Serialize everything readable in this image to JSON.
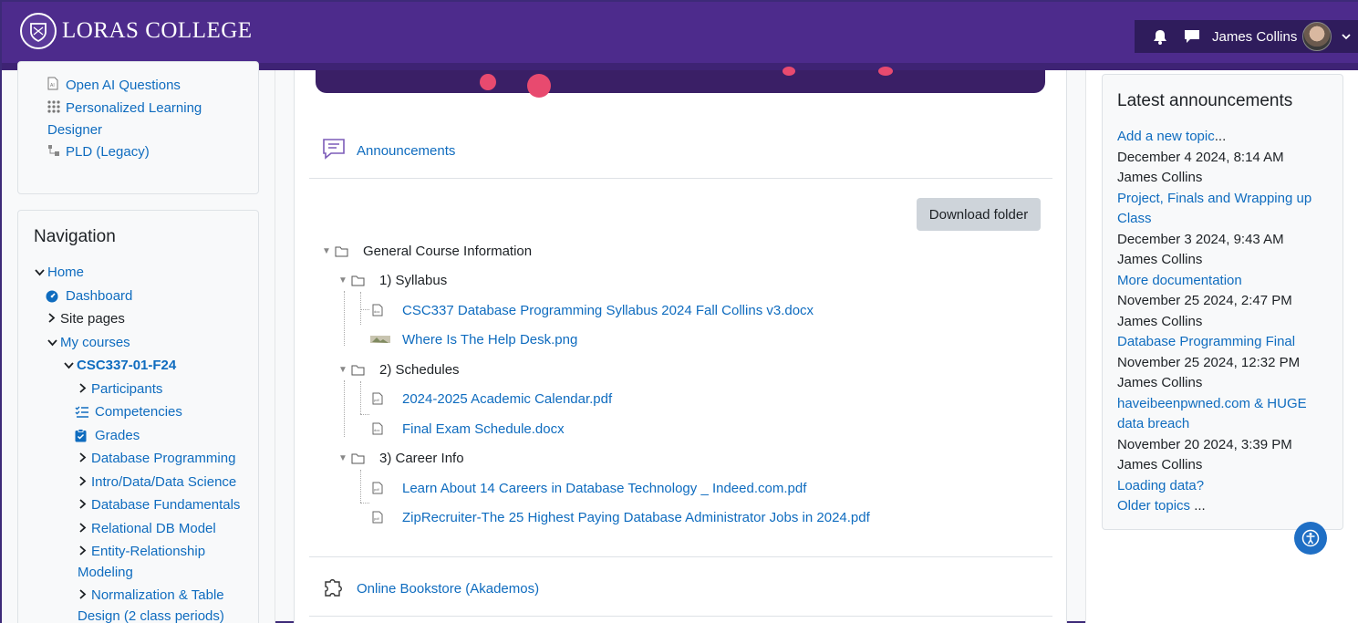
{
  "header": {
    "brand": "LORAS COLLEGE",
    "user_name": "James Collins"
  },
  "left_block": {
    "items": [
      {
        "label": "Open AI Questions",
        "icon": "ai-document-icon"
      },
      {
        "label": "Personalized Learning Designer",
        "icon": "grid-dots-icon"
      },
      {
        "label": "PLD (Legacy)",
        "icon": "tree-icon"
      }
    ]
  },
  "navigation": {
    "title": "Navigation",
    "home": "Home",
    "dashboard": "Dashboard",
    "site_pages": "Site pages",
    "my_courses": "My courses",
    "course": "CSC337-01-F24",
    "participants": "Participants",
    "competencies": "Competencies",
    "grades": "Grades",
    "sections": [
      "Database Programming",
      "Intro/Data/Data Science",
      "Database Fundamentals",
      "Relational DB Model",
      "Entity-Relationship",
      "Modeling",
      "Normalization & Table",
      "Design (2 class periods)"
    ]
  },
  "main": {
    "announcements_link": "Announcements",
    "download_button": "Download folder",
    "folder_root": "General Course Information",
    "folders": [
      {
        "name": "1) Syllabus",
        "files": [
          "CSC337 Database Programming Syllabus 2024 Fall Collins v3.docx",
          "Where Is The Help Desk.png"
        ]
      },
      {
        "name": "2) Schedules",
        "files": [
          "2024-2025 Academic Calendar.pdf",
          "Final Exam Schedule.docx"
        ]
      },
      {
        "name": "3) Career Info",
        "files": [
          "Learn About 14 Careers in Database Technology _ Indeed.com.pdf",
          "ZipRecruiter-The 25 Highest Paying Database Administrator Jobs in 2024.pdf"
        ]
      }
    ],
    "bookstore_link": "Online Bookstore (Akademos)"
  },
  "announcements": {
    "title": "Latest announcements",
    "add_topic": "Add a new topic",
    "add_topic_suffix": "...",
    "items": [
      {
        "date": "December 4 2024, 8:14 AM",
        "author": "James Collins",
        "link": "Project, Finals and Wrapping up"
      },
      {
        "date": "December 3 2024, 9:43 AM",
        "author": "James Collins",
        "link": "More documentation"
      },
      {
        "date": "November 25 2024, 2:47 PM",
        "author": "James Collins",
        "link": "Database Programming Final"
      },
      {
        "date": "November 25 2024, 12:32 PM",
        "author": "James Collins",
        "link": "haveibeenpwned.com & HUGE"
      },
      {
        "date": "November 20 2024, 3:39 PM",
        "author": "James Collins",
        "link": "Loading data?"
      }
    ],
    "first_link_cont": "Class",
    "hibp_cont": "data breach",
    "older": "Older topics",
    "older_suffix": " ..."
  },
  "colors": {
    "brand_purple": "#4d2b8c",
    "link": "#0f6cbf",
    "accent_pink": "#e84a6f"
  }
}
